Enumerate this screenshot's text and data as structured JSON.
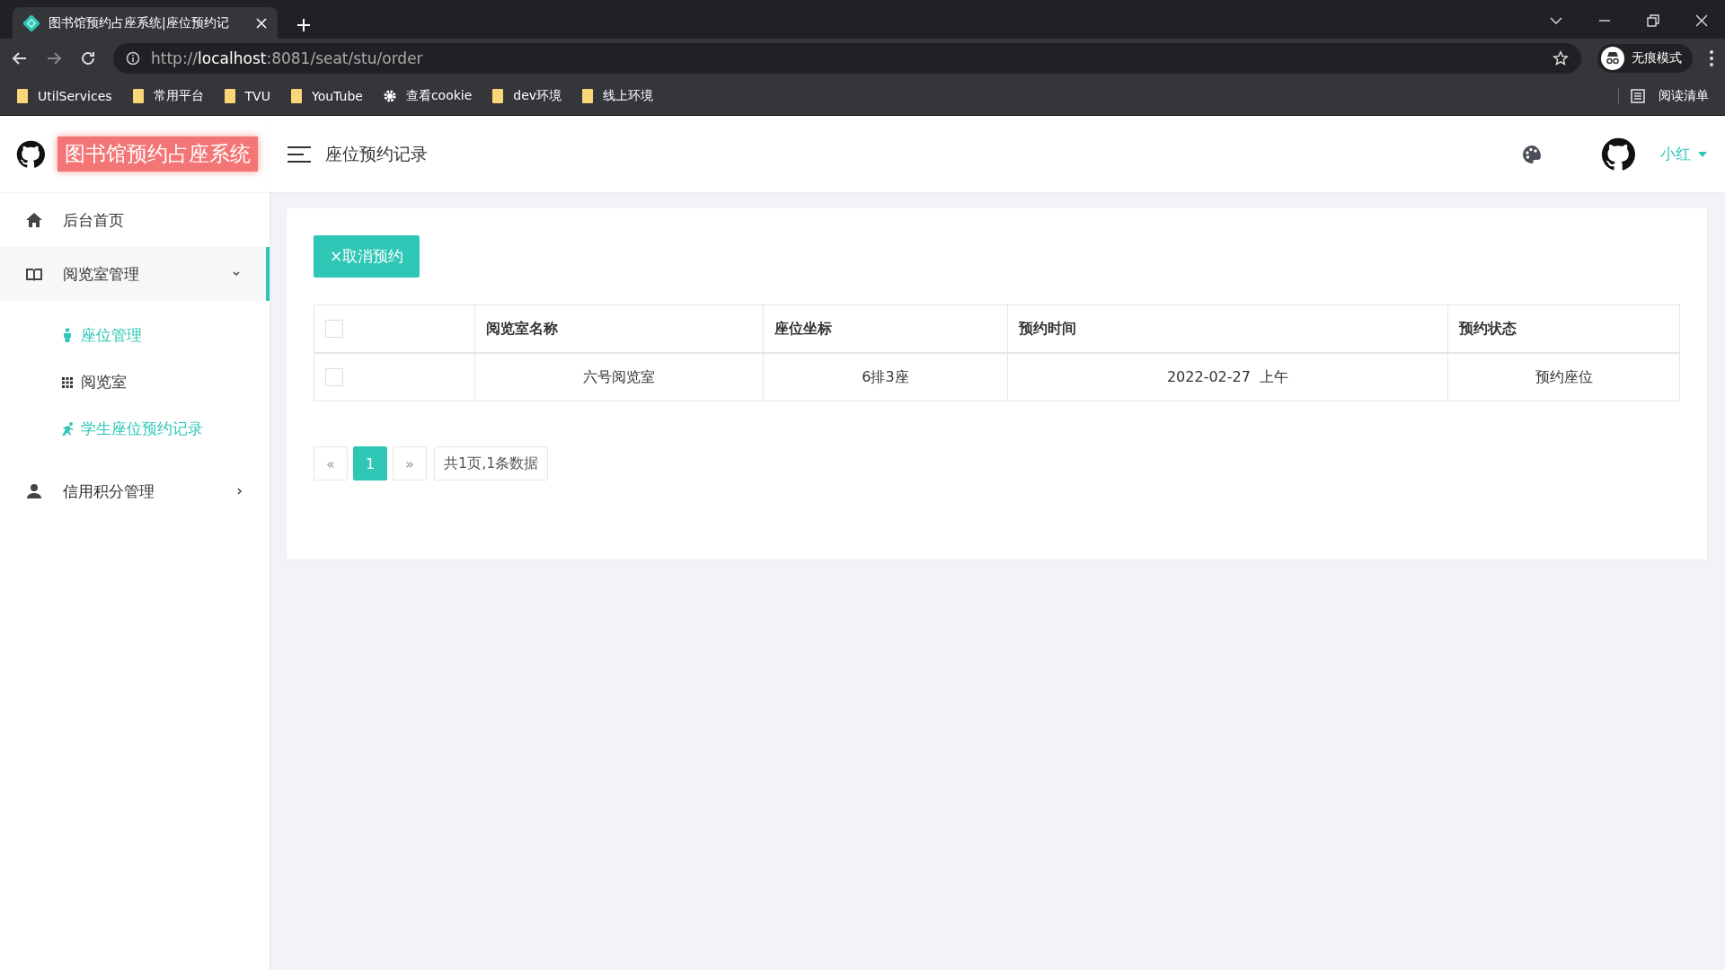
{
  "browser": {
    "tab": {
      "title": "图书馆预约占座系统|座位预约记"
    },
    "url": {
      "scheme": "http://",
      "host": "localhost",
      "rest": ":8081/seat/stu/order"
    },
    "profile": "无痕模式",
    "bookmarks": [
      {
        "label": "UtilServices",
        "kind": "folder"
      },
      {
        "label": "常用平台",
        "kind": "folder"
      },
      {
        "label": "TVU",
        "kind": "folder"
      },
      {
        "label": "YouTube",
        "kind": "folder"
      },
      {
        "label": "查看cookie",
        "kind": "gear"
      },
      {
        "label": "dev环境",
        "kind": "folder"
      },
      {
        "label": "线上环境",
        "kind": "folder"
      }
    ],
    "reading_list": "阅读清单"
  },
  "app": {
    "title": "图书馆预约占座系统",
    "page_title": "座位预约记录",
    "user": "小红"
  },
  "sidebar": {
    "items": [
      {
        "label": "后台首页",
        "kind": "link",
        "selected": false
      },
      {
        "label": "阅览室管理",
        "kind": "group",
        "selected": true,
        "expanded": true,
        "children": [
          {
            "label": "座位管理",
            "selected": true
          },
          {
            "label": "阅览室",
            "selected": false
          },
          {
            "label": "学生座位预约记录",
            "selected": true
          }
        ]
      },
      {
        "label": "信用积分管理",
        "kind": "group",
        "selected": false,
        "expanded": false
      }
    ]
  },
  "toolbar": {
    "cancel_button": "×取消预约"
  },
  "table": {
    "columns": [
      "阅览室名称",
      "座位坐标",
      "预约时间",
      "预约状态"
    ],
    "header_checked": false,
    "rows": [
      {
        "checked": false,
        "cells": [
          "六号阅览室",
          "6排3座",
          "2022-02-27  上午",
          "预约座位"
        ]
      }
    ]
  },
  "pagination": {
    "prev": "«",
    "pages": [
      {
        "label": "1",
        "selected": true
      }
    ],
    "next": "»",
    "summary": "共1页,1条数据"
  }
}
